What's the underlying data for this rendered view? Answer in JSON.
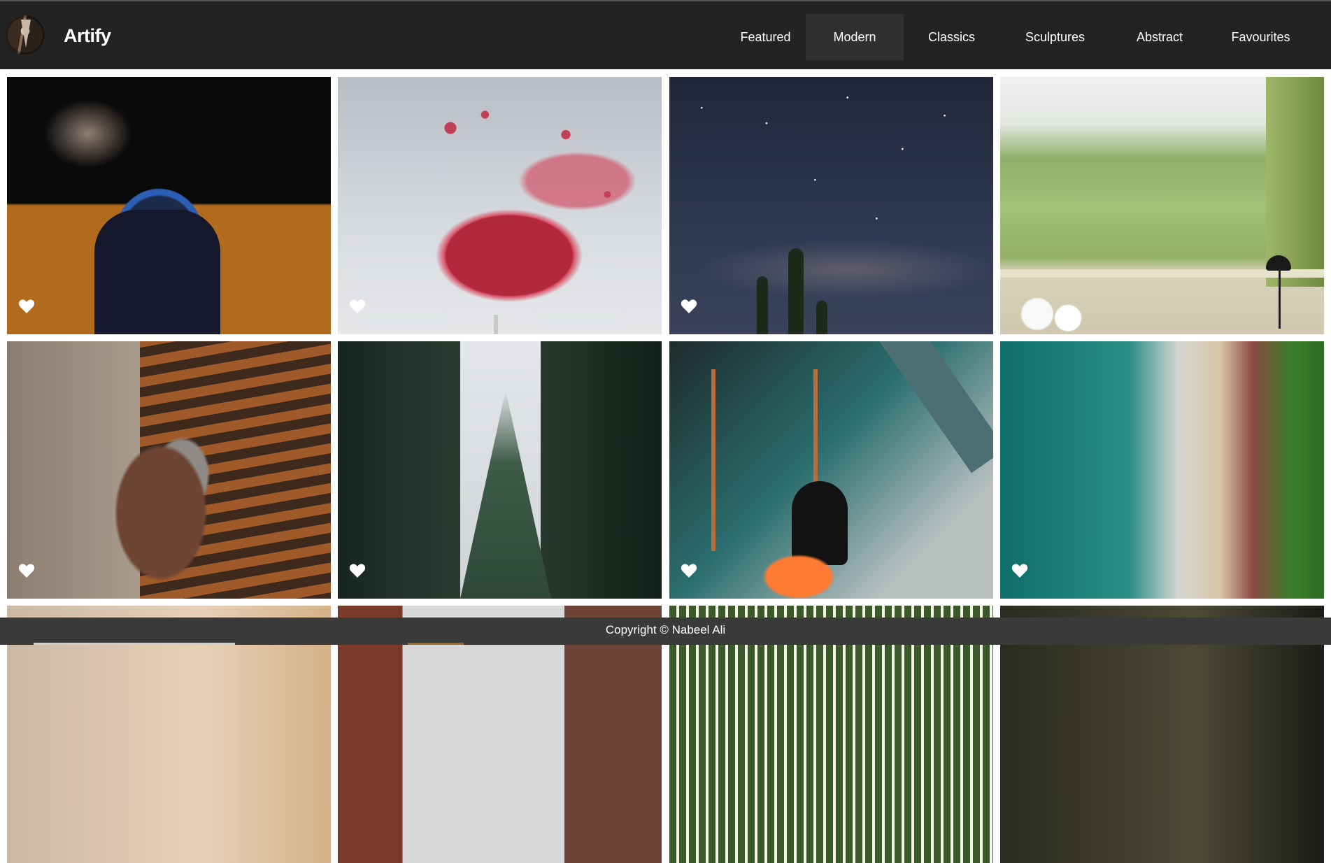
{
  "brand": {
    "logo_icon": "artify-logo-icon",
    "name": "Artify"
  },
  "nav": {
    "items": [
      {
        "label": "Featured",
        "active": false
      },
      {
        "label": "Modern",
        "active": true
      },
      {
        "label": "Classics",
        "active": false
      },
      {
        "label": "Sculptures",
        "active": false
      },
      {
        "label": "Abstract",
        "active": false
      },
      {
        "label": "Favourites",
        "active": false
      }
    ]
  },
  "gallery": {
    "favourite_icon": "heart-icon",
    "tiles": [
      {
        "subject": "ram sculpture"
      },
      {
        "subject": "wine splash"
      },
      {
        "subject": "night sky cactus"
      },
      {
        "subject": "garden window"
      },
      {
        "subject": "gnome statue"
      },
      {
        "subject": "pine trees"
      },
      {
        "subject": "gas mask smoke"
      },
      {
        "subject": "coastline aerial"
      },
      {
        "subject": "partial row"
      },
      {
        "subject": "partial row"
      },
      {
        "subject": "partial row"
      },
      {
        "subject": "partial row"
      }
    ]
  },
  "footer": {
    "copyright": "Copyright © Nabeel Ali"
  },
  "colors": {
    "header_bg": "#232323",
    "nav_active_bg": "#303030",
    "footer_bg": "#3a3a3a",
    "text": "#ffffff"
  }
}
